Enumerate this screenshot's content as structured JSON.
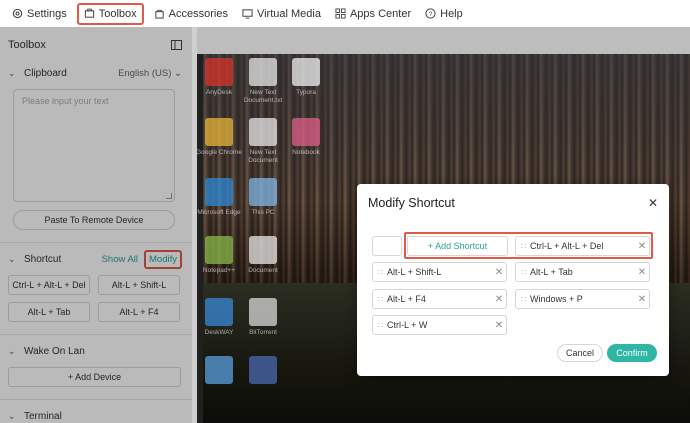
{
  "topbar": {
    "items": [
      {
        "label": "Settings",
        "icon": "gear-icon"
      },
      {
        "label": "Toolbox",
        "icon": "toolbox-icon"
      },
      {
        "label": "Accessories",
        "icon": "bag-icon"
      },
      {
        "label": "Virtual Media",
        "icon": "monitor-icon"
      },
      {
        "label": "Apps Center",
        "icon": "grid-icon"
      },
      {
        "label": "Help",
        "icon": "help-icon"
      }
    ]
  },
  "panel": {
    "title": "Toolbox",
    "clipboard": {
      "title": "Clipboard",
      "language": "English (US)",
      "placeholder": "Please input your text",
      "paste_label": "Paste To Remote Device"
    },
    "shortcut": {
      "title": "Shortcut",
      "show_all": "Show All",
      "modify": "Modify",
      "buttons": [
        "Ctrl-L + Alt-L + Del",
        "Alt-L + Shift-L",
        "Alt-L + Tab",
        "Alt-L + F4"
      ]
    },
    "wake_on_lan": {
      "title": "Wake On Lan",
      "add_device": "+ Add Device"
    },
    "terminal": {
      "title": "Terminal"
    }
  },
  "desktop": {
    "icons": [
      {
        "label": "AnyDesk",
        "color": "#d9342b"
      },
      {
        "label": "New Text Document.txt",
        "color": "#e8e8e8"
      },
      {
        "label": "Typora",
        "color": "#f2f2f2"
      },
      {
        "label": "Google Chrome",
        "color": "#e8b43a"
      },
      {
        "label": "New Text Document",
        "color": "#e8e8e8"
      },
      {
        "label": "Notebook",
        "color": "#e05f8a"
      },
      {
        "label": "Microsoft Edge",
        "color": "#2f8ad8"
      },
      {
        "label": "This PC",
        "color": "#7fb7e8"
      },
      {
        "label": "Notepad++",
        "color": "#8ab84a"
      },
      {
        "label": "Document",
        "color": "#e8e8e8"
      },
      {
        "label": "DeskWAY",
        "color": "#3a8ad8"
      },
      {
        "label": "BitTorrent",
        "color": "#d8d8d8"
      },
      {
        "label": "",
        "color": "#5aa0e0"
      },
      {
        "label": "",
        "color": "#4a6ab0"
      }
    ]
  },
  "modal": {
    "title": "Modify Shortcut",
    "add_shortcut": "+ Add Shortcut",
    "shortcuts": [
      "Ctrl-L + Alt-L + Del",
      "Alt-L + Shift-L",
      "Alt-L + Tab",
      "Alt-L + F4",
      "Windows + P",
      "Ctrl-L + W"
    ],
    "cancel": "Cancel",
    "confirm": "Confirm"
  },
  "colors": {
    "accent": "#2eb5a6",
    "highlight": "#e05a4a"
  }
}
